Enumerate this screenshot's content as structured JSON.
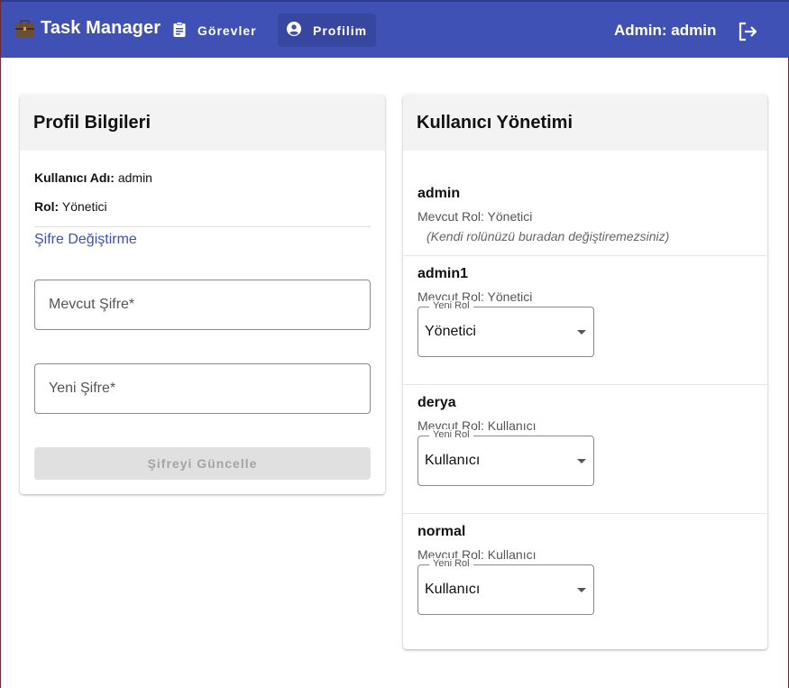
{
  "header": {
    "brand": "Task Manager",
    "brand_icon": "briefcase-icon",
    "nav": {
      "tasks_label": "Görevler",
      "profile_label": "Profilim"
    },
    "admin_label": "Admin: admin",
    "colors": {
      "appbar": "#3f51b5",
      "link": "#3f51b5"
    }
  },
  "profile": {
    "title": "Profil Bilgileri",
    "username_key": "Kullanıcı Adı:",
    "username_value": "admin",
    "role_key": "Rol:",
    "role_value": "Yönetici",
    "change_password_link": "Şifre Değiştirme",
    "current_password_placeholder": "Mevcut Şifre*",
    "new_password_placeholder": "Yeni Şifre*",
    "update_button": "Şifreyi Güncelle"
  },
  "users": {
    "title": "Kullanıcı Yönetimi",
    "new_role_label": "Yeni Rol",
    "list": [
      {
        "name": "admin",
        "current_role": "Mevcut Rol: Yönetici",
        "note": "(Kendi rolünüzü buradan değiştiremezsiniz)"
      },
      {
        "name": "admin1",
        "current_role": "Mevcut Rol: Yönetici",
        "selected_role": "Yönetici"
      },
      {
        "name": "derya",
        "current_role": "Mevcut Rol: Kullanıcı",
        "selected_role": "Kullanıcı"
      },
      {
        "name": "normal",
        "current_role": "Mevcut Rol: Kullanıcı",
        "selected_role": "Kullanıcı"
      }
    ]
  }
}
